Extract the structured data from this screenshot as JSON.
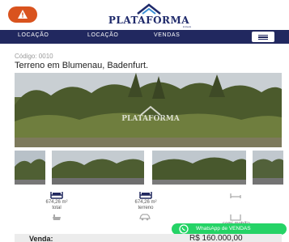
{
  "header": {
    "alert_icon": "warning-icon",
    "logo_text": "PLATAFORMA",
    "logo_sub": "imóveis",
    "brand_color": "#21285f",
    "alert_color": "#d9531e"
  },
  "nav": {
    "items": [
      {
        "label": "LOCAÇÃO"
      },
      {
        "label": "LOCAÇÃO"
      },
      {
        "label": "VENDAS"
      }
    ],
    "menu_icon": "hamburger-icon"
  },
  "listing": {
    "code_label": "Código: 0010",
    "title": "Terreno em Blumenau, Badenfurt.",
    "watermark": "PLATAFORMA"
  },
  "features": {
    "area_total": "674,26 m²",
    "area_total_label": "total",
    "area_land": "674,26 m²",
    "area_land_label": "terreno",
    "icons": [
      "area-icon",
      "area-icon",
      "bed-icon",
      "bath-icon",
      "car-icon",
      "furnished-icon"
    ],
    "furnished_label": "semi-mobília"
  },
  "price": {
    "label": "Venda:",
    "value": "R$ 160.000,00"
  },
  "whatsapp": {
    "label": "WhatsApp de VENDAS",
    "icon": "whatsapp-icon",
    "color": "#25d366"
  }
}
